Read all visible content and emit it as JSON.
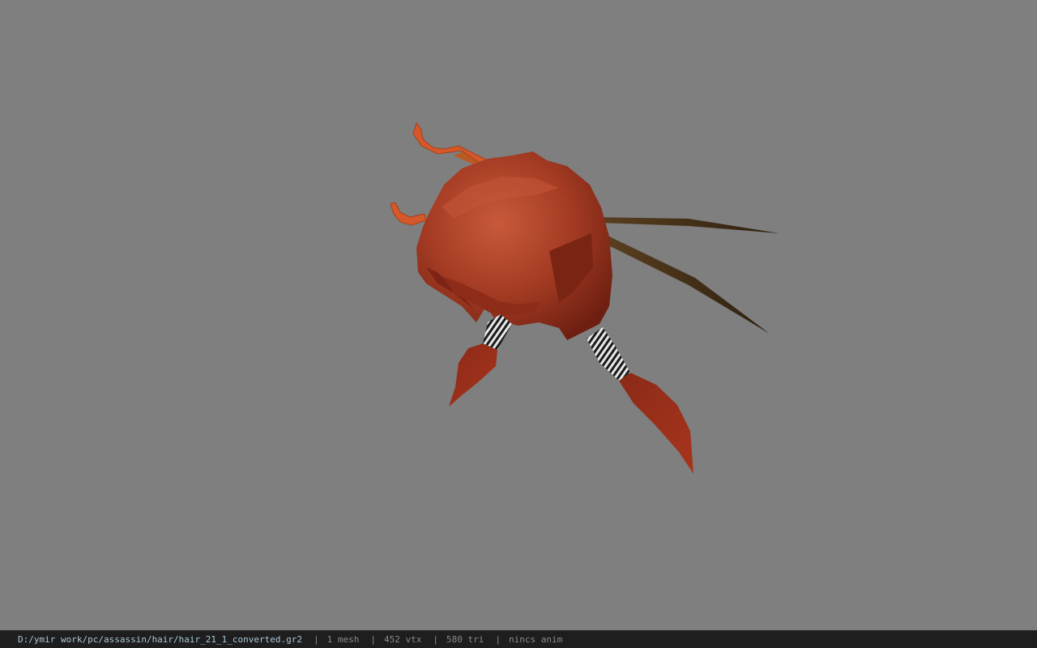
{
  "statusbar": {
    "file_path": "D:/ymir work/pc/assassin/hair/hair_21_1_converted.gr2",
    "separator": "|",
    "mesh_count": "1 mesh",
    "vertex_count": "452 vtx",
    "triangle_count": "580 tri",
    "anim_status": "nincs anim"
  },
  "viewport": {
    "background_color": "#7f7f7f",
    "model": "hair-mesh",
    "colors": {
      "hair_main": "#a23a22",
      "hair_dark": "#6e1f12",
      "hair_light": "#c85a3a",
      "hairpin_orange": "#d4582a",
      "chopstick_brown": "#4a3418",
      "ribbon_white": "#e8e8e8",
      "ribbon_black": "#1a1a1a"
    }
  }
}
